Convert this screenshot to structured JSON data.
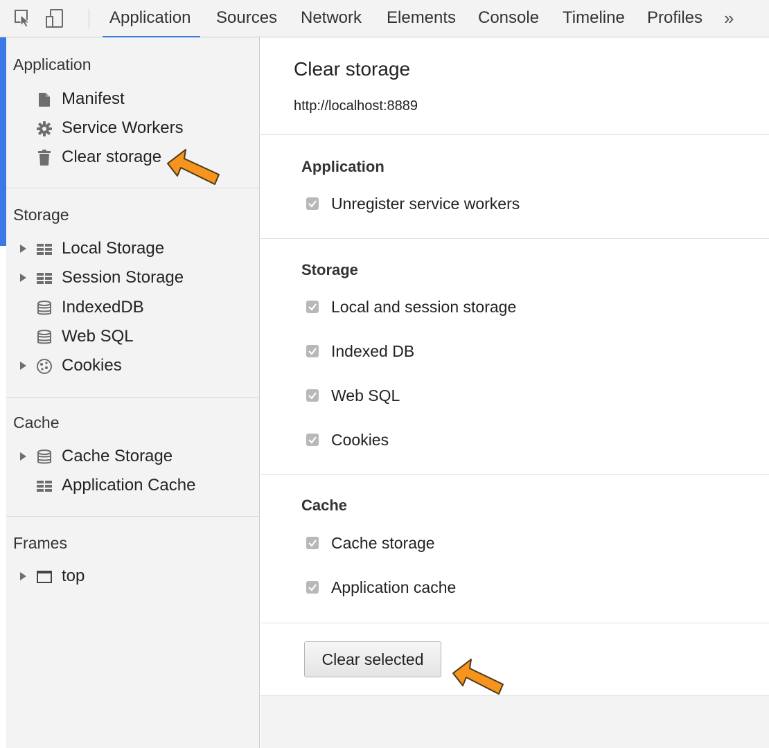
{
  "toolbar": {
    "tabs": [
      {
        "label": "Application",
        "active": true
      },
      {
        "label": "Sources"
      },
      {
        "label": "Network"
      },
      {
        "label": "Elements"
      },
      {
        "label": "Console"
      },
      {
        "label": "Timeline"
      },
      {
        "label": "Profiles"
      }
    ],
    "overflow": "»"
  },
  "sidebar": {
    "sections": [
      {
        "header": "Application",
        "items": [
          {
            "label": "Manifest",
            "icon": "file-icon"
          },
          {
            "label": "Service Workers",
            "icon": "gear-icon"
          },
          {
            "label": "Clear storage",
            "icon": "trash-icon",
            "selected": true
          }
        ]
      },
      {
        "header": "Storage",
        "items": [
          {
            "label": "Local Storage",
            "icon": "grid-icon",
            "expandable": true
          },
          {
            "label": "Session Storage",
            "icon": "grid-icon",
            "expandable": true
          },
          {
            "label": "IndexedDB",
            "icon": "database-icon"
          },
          {
            "label": "Web SQL",
            "icon": "database-icon"
          },
          {
            "label": "Cookies",
            "icon": "cookie-icon",
            "expandable": true
          }
        ]
      },
      {
        "header": "Cache",
        "items": [
          {
            "label": "Cache Storage",
            "icon": "database-icon",
            "expandable": true
          },
          {
            "label": "Application Cache",
            "icon": "grid-icon"
          }
        ]
      },
      {
        "header": "Frames",
        "items": [
          {
            "label": "top",
            "icon": "frame-icon",
            "expandable": true
          }
        ]
      }
    ]
  },
  "main": {
    "title": "Clear storage",
    "origin": "http://localhost:8889",
    "sections": [
      {
        "title": "Application",
        "checkboxes": [
          {
            "label": "Unregister service workers",
            "checked": true
          }
        ]
      },
      {
        "title": "Storage",
        "checkboxes": [
          {
            "label": "Local and session storage",
            "checked": true
          },
          {
            "label": "Indexed DB",
            "checked": true
          },
          {
            "label": "Web SQL",
            "checked": true
          },
          {
            "label": "Cookies",
            "checked": true
          }
        ]
      },
      {
        "title": "Cache",
        "checkboxes": [
          {
            "label": "Cache storage",
            "checked": true
          },
          {
            "label": "Application cache",
            "checked": true
          }
        ]
      }
    ],
    "clear_button": "Clear selected"
  },
  "colors": {
    "accent": "#3879d9",
    "sidebar_bg": "#f3f3f3",
    "annotation_arrow": "#f7941d"
  }
}
